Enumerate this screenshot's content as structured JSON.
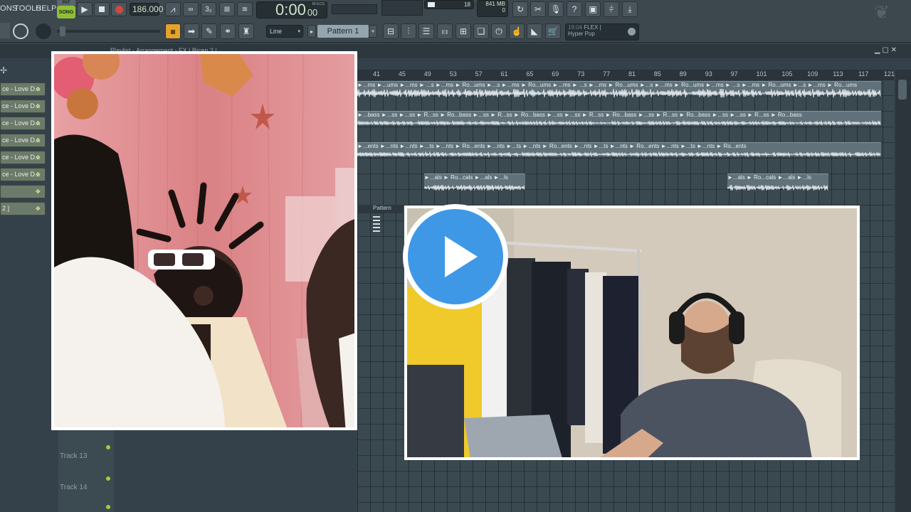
{
  "menu": {
    "items": [
      "ONS",
      "TOOLS",
      "HELP"
    ]
  },
  "transport": {
    "song_mode_label": "SONG",
    "pattern_mode_label": "PAT",
    "tempo": "186.000",
    "time_main": "0:00",
    "time_sub": "00",
    "time_unit": "M:S:CS",
    "cpu_value": "18",
    "memory": "841 MB",
    "voices": "0"
  },
  "toolbar2": {
    "snap_label": "Line",
    "pattern_label": "Pattern 1",
    "plugin_news": "FLEX |",
    "plugin_preset": "Hyper Pop",
    "news_prefix": "19:04"
  },
  "playlist": {
    "title": "Playlist - Arrangement › FX | Bicep 2 |",
    "ruler": [
      "41",
      "45",
      "49",
      "53",
      "57",
      "61",
      "65",
      "69",
      "73",
      "77",
      "81",
      "85",
      "89",
      "93",
      "97",
      "101",
      "105",
      "109",
      "113",
      "117",
      "121"
    ],
    "tracks": [
      {
        "label": "ce - Love D..."
      },
      {
        "label": "ce - Love D..."
      },
      {
        "label": "ce - Love D..."
      },
      {
        "label": "ce - Love D..."
      },
      {
        "label": "ce - Love D..."
      },
      {
        "label": "ce - Love D..."
      },
      {
        "label": ""
      },
      {
        "label": "2 ]"
      }
    ],
    "clip_rows": [
      {
        "text": "►...ms ►...ums ►...ms ► ...s ►...ms ► Ro...ums ►...s ►...ms ► Ro...ums ►...ms ► ...s ►...ms ► Ro...ums ►...s ►...ms ► Ro...ums ►...ms ► ...s ►...ms ► Ro...ums ►...s ►...ms ► Ro...ums"
      },
      {
        "text": "►...bass ►...ss ►...ss ► R...ss ► Ro...bass ►...ss ► R...ss ► Ro...bass ►...ss ►...ss ► R...ss ► Ro...bass ►...ss ► R...ss ► Ro...bass ►...ss ►...ss ► R...ss ► Ro...bass"
      },
      {
        "text": "►...ents ►...nts ►...nts ►...ts ►...nts ► Ro...ents ►...nts ►...ts ►...nts ► Ro...ents ►...nts ►...ts ►...nts ► Ro...ents ►...nts ►...ts ►...nts ► Ro...ents"
      }
    ],
    "vocal_clip_text": "►...als ► Ro...cals ►...als ►...ls",
    "pattern_tab_label": "Pattern",
    "lower_tracks": [
      "Track 13",
      "Track 14"
    ]
  },
  "colors": {
    "accent_song": "#8fbf39",
    "play_button": "#3f98e6",
    "clip": "#60717a",
    "background": "#34414a"
  },
  "icons": [
    "play-icon",
    "stop-icon",
    "record-icon",
    "metronome-icon",
    "typing-keyboard-icon",
    "mixer-icon",
    "piano-roll-icon",
    "browser-icon",
    "save-icon",
    "help-icon",
    "export-icon",
    "fl-logo-icon"
  ]
}
